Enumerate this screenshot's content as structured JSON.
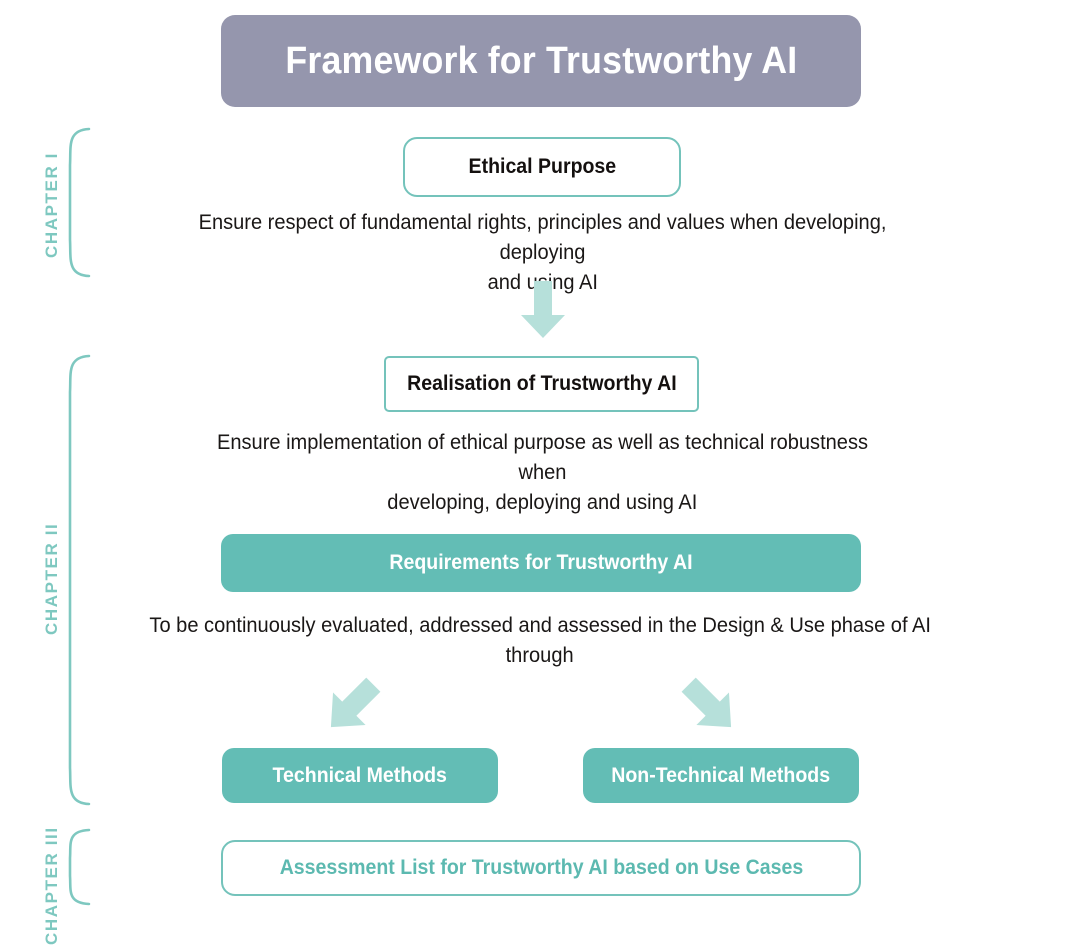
{
  "title": {
    "text": "Framework for Trustworthy AI",
    "bar_color": "#9596ad",
    "text_color": "#ffffff"
  },
  "colors": {
    "teal_solid": "#63bdb5",
    "teal_border": "#74c3bb",
    "teal_text": "#5cb9b0",
    "teal_label": "#7ec8c0",
    "arrow_fill": "#b6e0da",
    "banner": "#9596ad",
    "body_text": "#1a1716",
    "page_background": "#ffffff"
  },
  "chapters": [
    {
      "label": "CHAPTER I",
      "name": "chapter-1"
    },
    {
      "label": "CHAPTER II",
      "name": "chapter-2"
    },
    {
      "label": "CHAPTER III",
      "name": "chapter-3"
    }
  ],
  "nodes": [
    {
      "id": "ethical-purpose",
      "label": "Ethical Purpose",
      "style": "outline-round",
      "text": "dark"
    },
    {
      "id": "realisation",
      "label": "Realisation of Trustworthy AI",
      "style": "outline-sharp",
      "text": "dark"
    },
    {
      "id": "requirements",
      "label": "Requirements for Trustworthy AI",
      "style": "filled",
      "text": "white"
    },
    {
      "id": "technical",
      "label": "Technical Methods",
      "style": "filled",
      "text": "white"
    },
    {
      "id": "non-technical",
      "label": "Non-Technical Methods",
      "style": "filled",
      "text": "white"
    },
    {
      "id": "assessment-list",
      "label": "Assessment List for Trustworthy AI based on Use Cases",
      "style": "outline-round",
      "text": "teal"
    }
  ],
  "captions": [
    {
      "id": "caption-ethical-purpose",
      "line1": "Ensure respect of fundamental rights, principles and values when developing, deploying",
      "line2": "and using AI"
    },
    {
      "id": "caption-realisation",
      "line1": "Ensure implementation of ethical purpose as well as technical robustness when",
      "line2": "developing, deploying and using AI"
    },
    {
      "id": "caption-requirements",
      "line1": "To be continuously evaluated, addressed and assessed in the Design & Use phase of AI",
      "line2": "through"
    }
  ],
  "arrows": [
    {
      "id": "arrow-down-main",
      "direction": "down",
      "icon": "arrow-down-icon"
    },
    {
      "id": "arrow-down-left",
      "direction": "down-left",
      "icon": "arrow-down-left-icon"
    },
    {
      "id": "arrow-down-right",
      "direction": "down-right",
      "icon": "arrow-down-right-icon"
    }
  ]
}
